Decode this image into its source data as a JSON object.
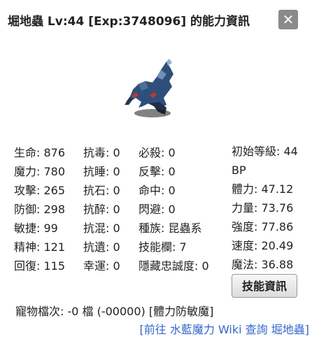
{
  "title": "堀地蟲 Lv:44 [Exp:3748096] 的能力資訊",
  "close_symbol": "✕",
  "sprite_icon": "monster-sprite",
  "stats": {
    "col1": [
      "生命: 876",
      "魔力: 780",
      "攻擊: 265",
      "防御: 298",
      "敏捷: 99",
      "精神: 121",
      "回復: 115"
    ],
    "col2": [
      "抗毒: 0",
      "抗睡: 0",
      "抗石: 0",
      "抗醉: 0",
      "抗混: 0",
      "抗遺: 0",
      "幸運: 0"
    ],
    "col3": [
      "必殺: 0",
      "反擊: 0",
      "命中: 0",
      "閃避: 0",
      "種族: 昆蟲系",
      "技能欄: 7",
      "隱藏忠誠度: 0"
    ]
  },
  "right": [
    "初始等級: 44",
    "BP",
    "體力: 47.12",
    "力量: 73.76",
    "強度: 77.86",
    "速度: 20.49",
    "魔法: 36.88"
  ],
  "skill_button": "技能資訊",
  "file_line": "寵物檔次: -0 檔 (-00000) [體力防敏魔]",
  "wiki_link": "[前往 水藍魔力 Wiki 查詢 堀地蟲]"
}
